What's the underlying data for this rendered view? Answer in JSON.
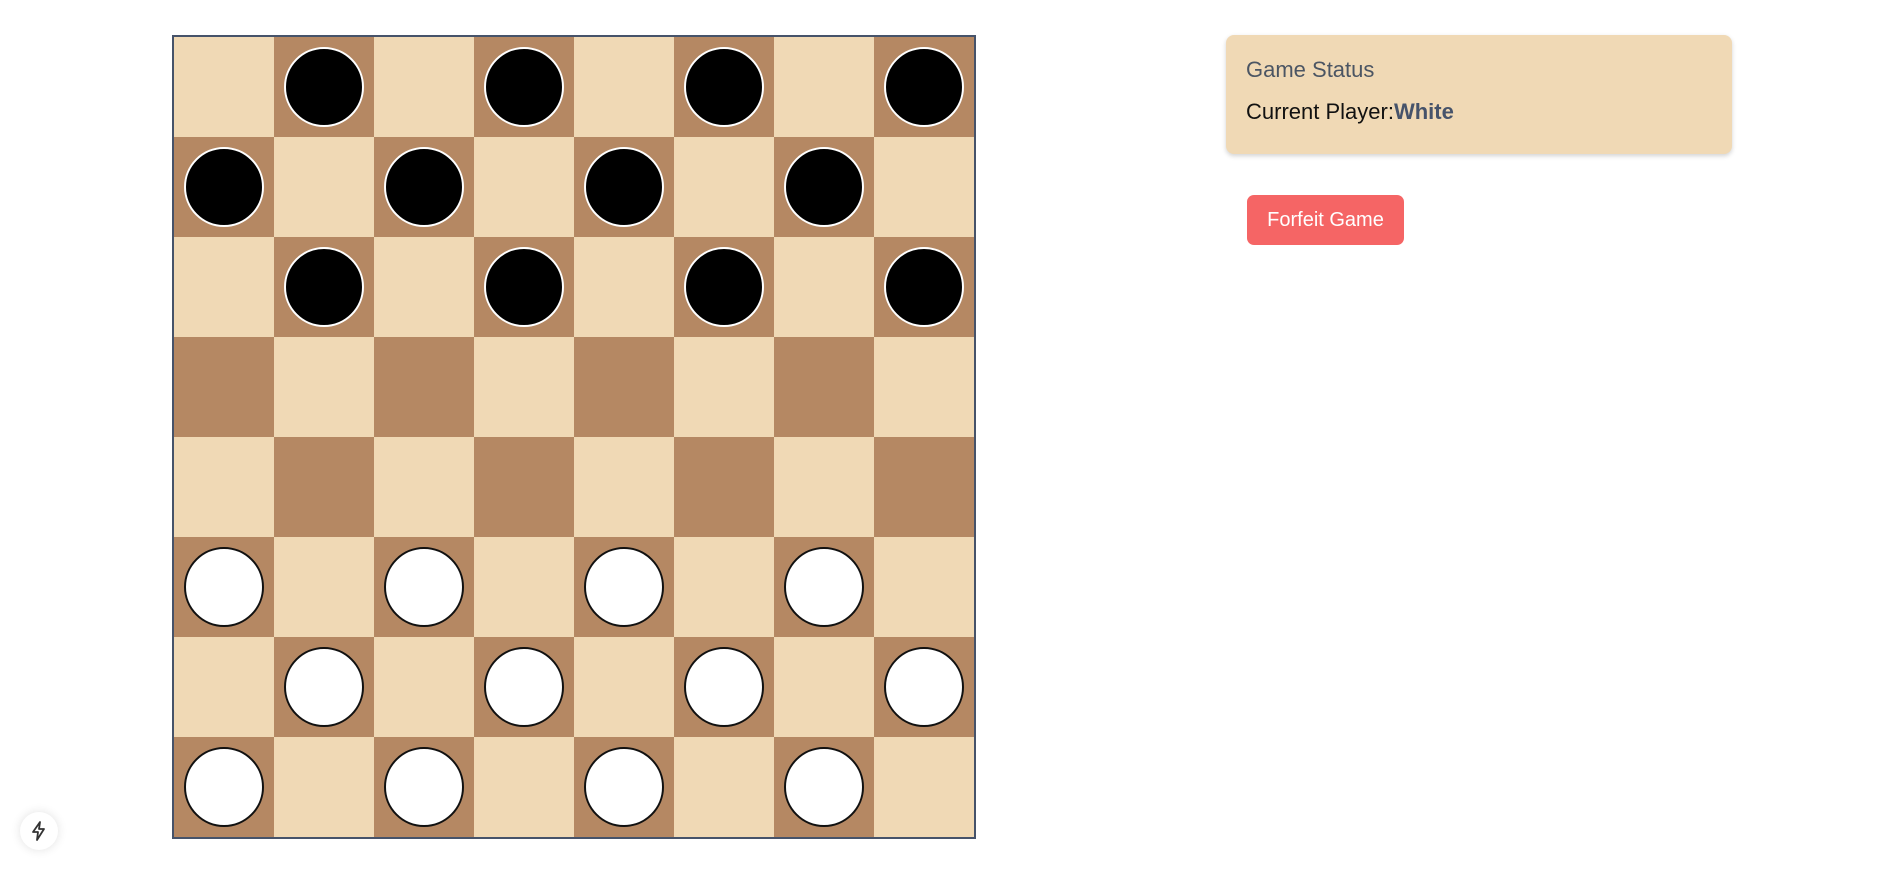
{
  "status": {
    "title": "Game Status",
    "current_player_label": "Current Player:",
    "current_player": "White"
  },
  "actions": {
    "forfeit_label": "Forfeit Game"
  },
  "board": {
    "rows": [
      [
        "",
        "black",
        "",
        "black",
        "",
        "black",
        "",
        "black"
      ],
      [
        "black",
        "",
        "black",
        "",
        "black",
        "",
        "black",
        ""
      ],
      [
        "",
        "black",
        "",
        "black",
        "",
        "black",
        "",
        "black"
      ],
      [
        "",
        "",
        "",
        "",
        "",
        "",
        "",
        ""
      ],
      [
        "",
        "",
        "",
        "",
        "",
        "",
        "",
        ""
      ],
      [
        "white",
        "",
        "white",
        "",
        "white",
        "",
        "white",
        ""
      ],
      [
        "",
        "white",
        "",
        "white",
        "",
        "white",
        "",
        "white"
      ],
      [
        "white",
        "",
        "white",
        "",
        "white",
        "",
        "white",
        ""
      ]
    ]
  },
  "colors": {
    "light_square": "#f0d9b5",
    "dark_square": "#b58863",
    "board_border": "#46536a",
    "forfeit_button": "#f56565"
  },
  "icons": {
    "corner_badge": "lightning-icon"
  }
}
